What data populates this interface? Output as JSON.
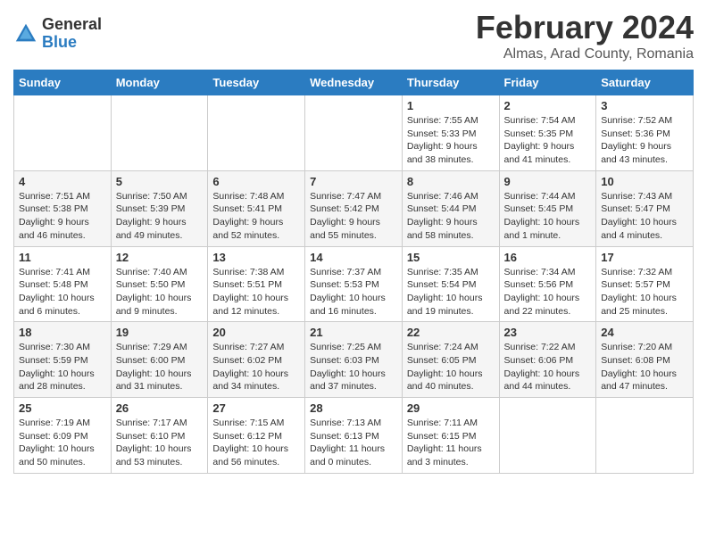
{
  "header": {
    "logo_general": "General",
    "logo_blue": "Blue",
    "month_title": "February 2024",
    "location": "Almas, Arad County, Romania"
  },
  "days_of_week": [
    "Sunday",
    "Monday",
    "Tuesday",
    "Wednesday",
    "Thursday",
    "Friday",
    "Saturday"
  ],
  "weeks": [
    [
      {
        "day": "",
        "info": ""
      },
      {
        "day": "",
        "info": ""
      },
      {
        "day": "",
        "info": ""
      },
      {
        "day": "",
        "info": ""
      },
      {
        "day": "1",
        "info": "Sunrise: 7:55 AM\nSunset: 5:33 PM\nDaylight: 9 hours\nand 38 minutes."
      },
      {
        "day": "2",
        "info": "Sunrise: 7:54 AM\nSunset: 5:35 PM\nDaylight: 9 hours\nand 41 minutes."
      },
      {
        "day": "3",
        "info": "Sunrise: 7:52 AM\nSunset: 5:36 PM\nDaylight: 9 hours\nand 43 minutes."
      }
    ],
    [
      {
        "day": "4",
        "info": "Sunrise: 7:51 AM\nSunset: 5:38 PM\nDaylight: 9 hours\nand 46 minutes."
      },
      {
        "day": "5",
        "info": "Sunrise: 7:50 AM\nSunset: 5:39 PM\nDaylight: 9 hours\nand 49 minutes."
      },
      {
        "day": "6",
        "info": "Sunrise: 7:48 AM\nSunset: 5:41 PM\nDaylight: 9 hours\nand 52 minutes."
      },
      {
        "day": "7",
        "info": "Sunrise: 7:47 AM\nSunset: 5:42 PM\nDaylight: 9 hours\nand 55 minutes."
      },
      {
        "day": "8",
        "info": "Sunrise: 7:46 AM\nSunset: 5:44 PM\nDaylight: 9 hours\nand 58 minutes."
      },
      {
        "day": "9",
        "info": "Sunrise: 7:44 AM\nSunset: 5:45 PM\nDaylight: 10 hours\nand 1 minute."
      },
      {
        "day": "10",
        "info": "Sunrise: 7:43 AM\nSunset: 5:47 PM\nDaylight: 10 hours\nand 4 minutes."
      }
    ],
    [
      {
        "day": "11",
        "info": "Sunrise: 7:41 AM\nSunset: 5:48 PM\nDaylight: 10 hours\nand 6 minutes."
      },
      {
        "day": "12",
        "info": "Sunrise: 7:40 AM\nSunset: 5:50 PM\nDaylight: 10 hours\nand 9 minutes."
      },
      {
        "day": "13",
        "info": "Sunrise: 7:38 AM\nSunset: 5:51 PM\nDaylight: 10 hours\nand 12 minutes."
      },
      {
        "day": "14",
        "info": "Sunrise: 7:37 AM\nSunset: 5:53 PM\nDaylight: 10 hours\nand 16 minutes."
      },
      {
        "day": "15",
        "info": "Sunrise: 7:35 AM\nSunset: 5:54 PM\nDaylight: 10 hours\nand 19 minutes."
      },
      {
        "day": "16",
        "info": "Sunrise: 7:34 AM\nSunset: 5:56 PM\nDaylight: 10 hours\nand 22 minutes."
      },
      {
        "day": "17",
        "info": "Sunrise: 7:32 AM\nSunset: 5:57 PM\nDaylight: 10 hours\nand 25 minutes."
      }
    ],
    [
      {
        "day": "18",
        "info": "Sunrise: 7:30 AM\nSunset: 5:59 PM\nDaylight: 10 hours\nand 28 minutes."
      },
      {
        "day": "19",
        "info": "Sunrise: 7:29 AM\nSunset: 6:00 PM\nDaylight: 10 hours\nand 31 minutes."
      },
      {
        "day": "20",
        "info": "Sunrise: 7:27 AM\nSunset: 6:02 PM\nDaylight: 10 hours\nand 34 minutes."
      },
      {
        "day": "21",
        "info": "Sunrise: 7:25 AM\nSunset: 6:03 PM\nDaylight: 10 hours\nand 37 minutes."
      },
      {
        "day": "22",
        "info": "Sunrise: 7:24 AM\nSunset: 6:05 PM\nDaylight: 10 hours\nand 40 minutes."
      },
      {
        "day": "23",
        "info": "Sunrise: 7:22 AM\nSunset: 6:06 PM\nDaylight: 10 hours\nand 44 minutes."
      },
      {
        "day": "24",
        "info": "Sunrise: 7:20 AM\nSunset: 6:08 PM\nDaylight: 10 hours\nand 47 minutes."
      }
    ],
    [
      {
        "day": "25",
        "info": "Sunrise: 7:19 AM\nSunset: 6:09 PM\nDaylight: 10 hours\nand 50 minutes."
      },
      {
        "day": "26",
        "info": "Sunrise: 7:17 AM\nSunset: 6:10 PM\nDaylight: 10 hours\nand 53 minutes."
      },
      {
        "day": "27",
        "info": "Sunrise: 7:15 AM\nSunset: 6:12 PM\nDaylight: 10 hours\nand 56 minutes."
      },
      {
        "day": "28",
        "info": "Sunrise: 7:13 AM\nSunset: 6:13 PM\nDaylight: 11 hours\nand 0 minutes."
      },
      {
        "day": "29",
        "info": "Sunrise: 7:11 AM\nSunset: 6:15 PM\nDaylight: 11 hours\nand 3 minutes."
      },
      {
        "day": "",
        "info": ""
      },
      {
        "day": "",
        "info": ""
      }
    ]
  ]
}
